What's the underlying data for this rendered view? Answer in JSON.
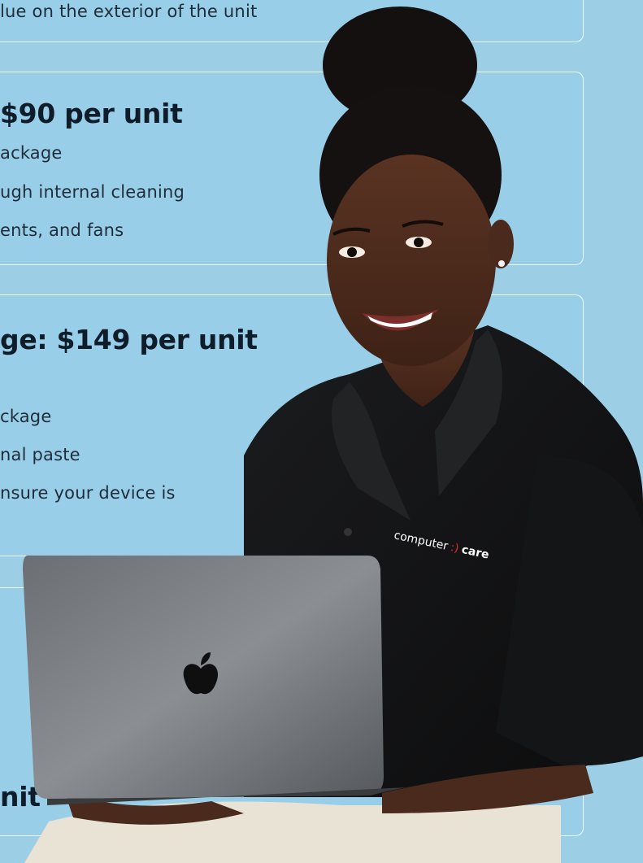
{
  "cards": [
    {
      "lines": [
        "lue on the exterior of the unit"
      ]
    },
    {
      "heading": "$90 per unit",
      "lines": [
        "ackage",
        "ugh internal cleaning",
        "ents, and fans"
      ]
    },
    {
      "heading": "ge: $149 per unit",
      "lines": [
        "ckage",
        "nal paste",
        "nsure your device is"
      ]
    },
    {
      "heading": "nit"
    }
  ],
  "shirt_logo": {
    "text_left": "computer",
    "symbol": ":)",
    "text_right": "care"
  },
  "laptop_logo": "apple-logo-icon"
}
